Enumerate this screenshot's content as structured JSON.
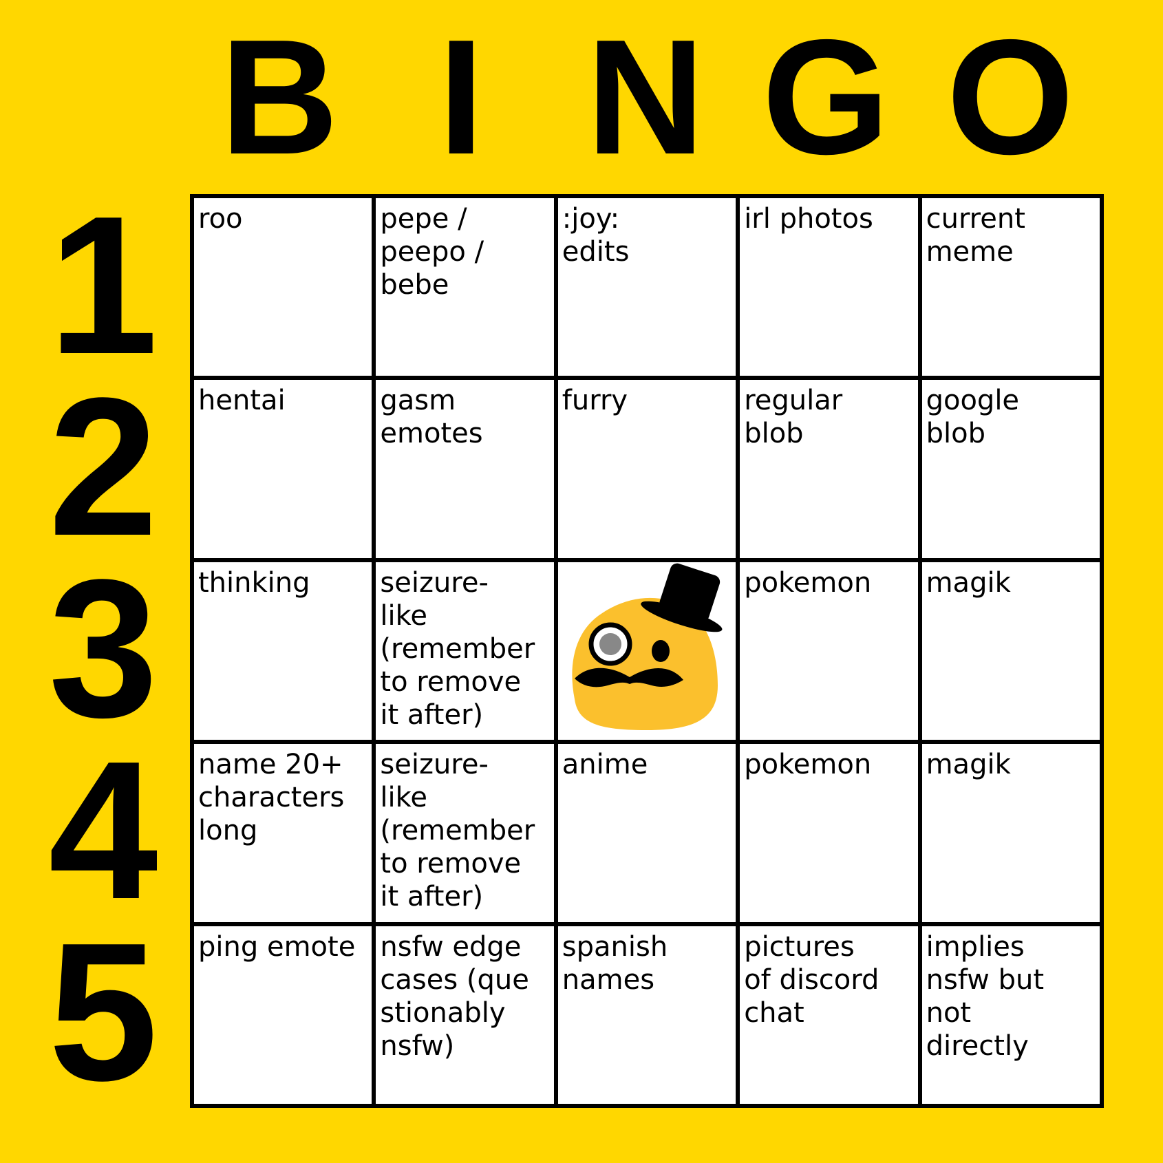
{
  "header": {
    "letters": [
      "B",
      "I",
      "N",
      "G",
      "O"
    ]
  },
  "rows": {
    "numbers": [
      "1",
      "2",
      "3",
      "4",
      "5"
    ]
  },
  "board": {
    "cells": [
      [
        "roo",
        "pepe /\npeepo /\nbebe",
        ":joy:\nedits",
        "irl photos",
        "current\nmeme"
      ],
      [
        "hentai",
        "gasm\nemotes",
        "furry",
        "regular\nblob",
        "google\nblob"
      ],
      [
        "thinking",
        "seizure-\nlike\n(remember\nto remove\nit after)",
        "",
        "pokemon",
        "magik"
      ],
      [
        "name 20+\ncharacters\nlong",
        "seizure-\nlike\n(remember\nto remove\nit after)",
        "anime",
        "pokemon",
        "magik"
      ],
      [
        "ping emote",
        "nsfw edge\ncases (que\nstionably\nnsfw)",
        "spanish\nnames",
        "pictures\nof discord\nchat",
        "implies\nnsfw but\nnot\ndirectly"
      ]
    ],
    "free_space_icon": "monocle-blob-emoji-icon"
  },
  "colors": {
    "background": "#FFD700",
    "blob": "#FBC02D",
    "grid_line": "#000000"
  }
}
